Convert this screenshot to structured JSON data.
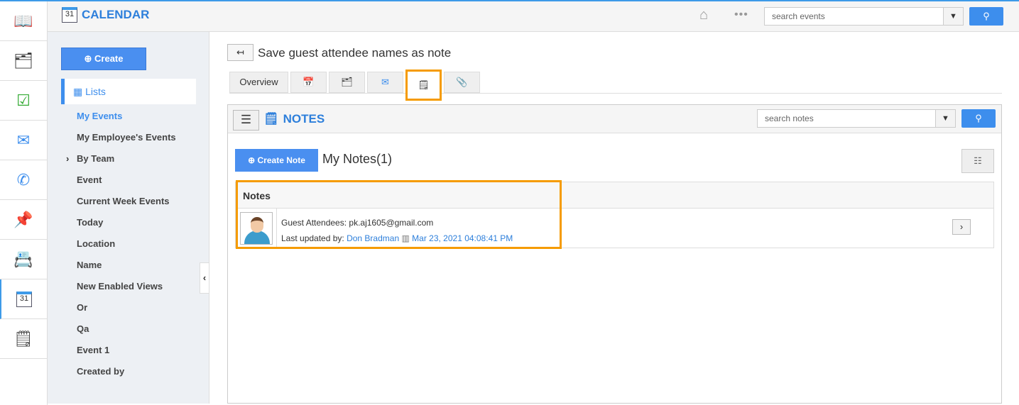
{
  "rail": {
    "items": [
      "book-icon",
      "form-icon",
      "task-icon",
      "mail-icon",
      "phone-icon",
      "pin-icon",
      "contact-icon",
      "calendar-icon",
      "notes-icon"
    ]
  },
  "header": {
    "app_title": "CALENDAR",
    "calendar_day": "31",
    "search_placeholder": "search events"
  },
  "sidebar": {
    "create_label": "Create",
    "lists_label": "Lists",
    "items": [
      "My Events",
      "My Employee's Events",
      "By Team",
      "Event",
      "Current Week Events",
      "Today",
      "Location",
      "Name",
      "New Enabled Views",
      "Or",
      "Qa",
      "Event 1",
      "Created by"
    ]
  },
  "main": {
    "page_title": "Save guest attendee names as note",
    "tabs": {
      "overview": "Overview"
    },
    "notes": {
      "title": "NOTES",
      "search_placeholder": "search notes",
      "create_note": "Create Note",
      "my_notes": "My Notes(1)",
      "column": "Notes",
      "row": {
        "text": "Guest Attendees: pk.aj1605@gmail.com",
        "updated_label": "Last updated by:",
        "author": "Don Bradman",
        "timestamp": "Mar 23, 2021 04:08:41 PM"
      }
    }
  },
  "colors": {
    "accent": "#3d8eed",
    "highlight": "#f59b00"
  }
}
